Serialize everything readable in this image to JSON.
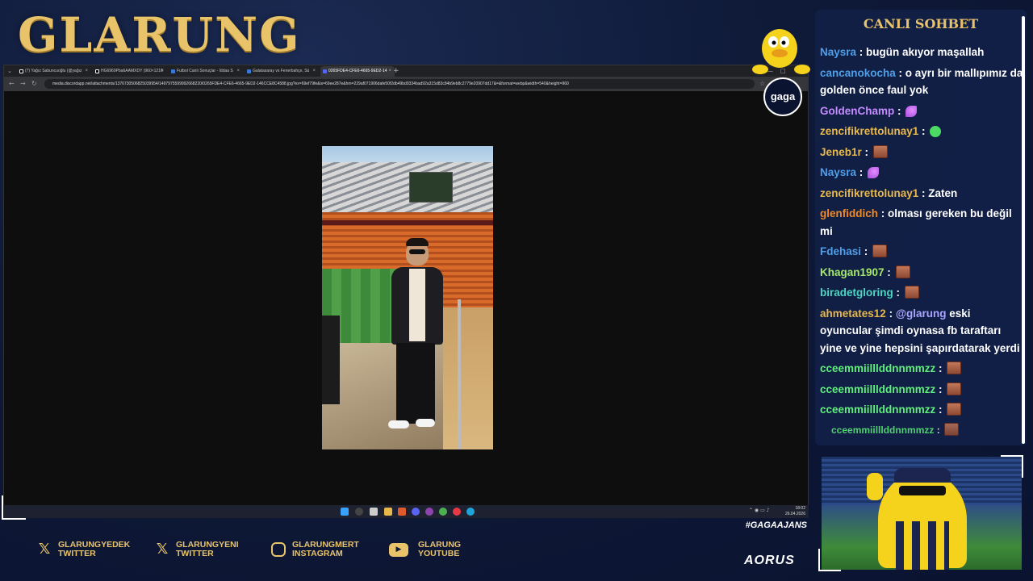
{
  "stream": {
    "logo_text": "GLARUNG",
    "hashtag": "#GAGAAJANS",
    "sponsor": "AORUS",
    "badge_text": "gaga"
  },
  "browser": {
    "tabs": [
      {
        "label": "(7) Yağız Sabuncuoğlu (@yağız",
        "active": false
      },
      {
        "label": "HG6969Pba6AAMXDY (960×1216",
        "active": false
      },
      {
        "label": "Futbol Canlı Sonuçlar - İddaa S",
        "active": false
      },
      {
        "label": "Galatasaray vs Fenerbahçe, Sü",
        "active": false
      },
      {
        "label": "0265FDE4-CFE6-4665-9ED2-14",
        "active": true
      }
    ],
    "new_tab": "+",
    "url": "media.discordapp.net/attachments/1376730506825039954/1497975599992668220/0265FDE4-CFE6-4665-9ED2-146CCE8C4588.jpg?ex=69ef79fe&is=69ee287e&hm=229af071906dafe50f2db49bd9334bad92a315d83c84b9eb8c2779e20907dd17&=&format=webp&width=540&height=960"
  },
  "taskbar": {
    "time": "18:02",
    "date": "26.04.2026"
  },
  "socials": [
    {
      "icon": "x-icon",
      "line1": "GLARUNGYEDEK",
      "line2": "TWITTER"
    },
    {
      "icon": "x-icon",
      "line1": "GLARUNGYENI",
      "line2": "TWITTER"
    },
    {
      "icon": "instagram-icon",
      "line1": "GLARUNGMERT",
      "line2": "INSTAGRAM"
    },
    {
      "icon": "youtube-icon",
      "line1": "GLARUNG",
      "line2": "YOUTUBE"
    }
  ],
  "chat": {
    "title": "CANLI SOHBET",
    "messages": [
      {
        "user": "Naysra",
        "color": "#4f9fe8",
        "text": "bugün akıyor maşallah",
        "emote": ""
      },
      {
        "user": "cancanokocha",
        "color": "#4f9fe8",
        "text": "o ayrı bir mallıpımız da golden önce faul yok",
        "emote": ""
      },
      {
        "user": "GoldenChamp",
        "color": "#c48cff",
        "text": "",
        "emote": "feather"
      },
      {
        "user": "zencifikrettolunay1",
        "color": "#e8b84a",
        "text": "",
        "emote": "cash"
      },
      {
        "user": "Jeneb1r",
        "color": "#e8b84a",
        "text": "",
        "emote": "face"
      },
      {
        "user": "Naysra",
        "color": "#4f9fe8",
        "text": "",
        "emote": "feather"
      },
      {
        "user": "zencifikrettolunay1",
        "color": "#e8b84a",
        "text": "Zaten",
        "emote": ""
      },
      {
        "user": "glenfiddich",
        "color": "#f08a24",
        "text": "olması gereken bu değil mi",
        "emote": ""
      },
      {
        "user": "Fdehasi",
        "color": "#4f9fe8",
        "text": "",
        "emote": "face"
      },
      {
        "user": "Khagan1907",
        "color": "#a5e86a",
        "text": "",
        "emote": "face"
      },
      {
        "user": "biradetgloring",
        "color": "#4fd6c2",
        "text": "",
        "emote": "face"
      },
      {
        "user": "ahmetates12",
        "color": "#e8b84a",
        "text": "eski oyuncular şimdi oynasa fb taraftarı yine ve yine hepsini şapırdatarak yerdi",
        "mention": "@glarung",
        "emote": ""
      },
      {
        "user": "cceemmiilllddnnmmzz",
        "color": "#5df07a",
        "text": "",
        "emote": "face"
      },
      {
        "user": "cceemmiilllddnnmmzz",
        "color": "#5df07a",
        "text": "",
        "emote": "face"
      },
      {
        "user": "cceemmiilllddnnmmzz",
        "color": "#5df07a",
        "text": "",
        "emote": "face"
      },
      {
        "user": "cceemmiilllddnnmmzz",
        "color": "#5df07a",
        "text": "",
        "emote": "face"
      }
    ]
  },
  "colors": {
    "gold": "#e8c36a",
    "panel": "#122048"
  }
}
